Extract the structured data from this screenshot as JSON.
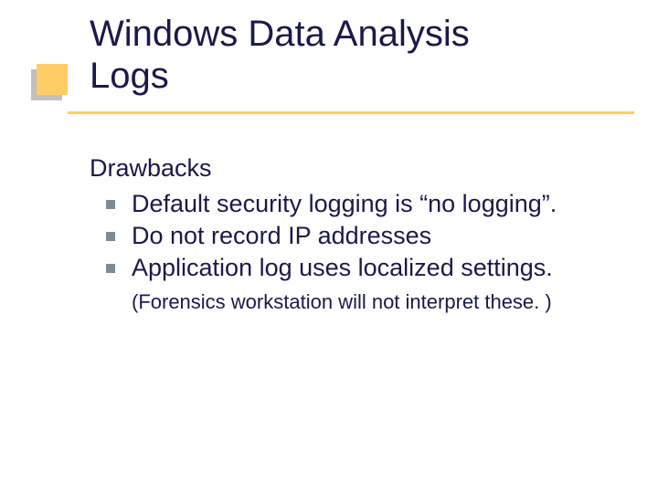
{
  "title_line1": "Windows Data Analysis",
  "title_line2": "Logs",
  "lead": "Drawbacks",
  "bullets": {
    "b0": "Default security logging is “no logging”.",
    "b1": "Do not record IP addresses",
    "b2": "Application log uses localized settings."
  },
  "note": "(Forensics workstation will not interpret these. )"
}
